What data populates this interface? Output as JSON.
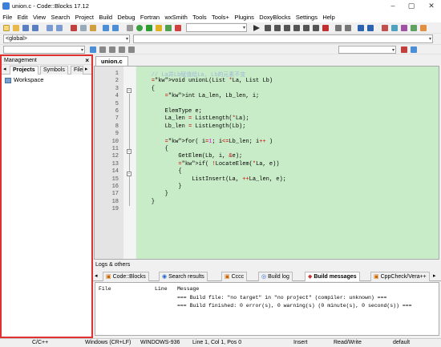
{
  "window": {
    "title": "union.c - Code::Blocks 17.12"
  },
  "menu": [
    "File",
    "Edit",
    "View",
    "Search",
    "Project",
    "Build",
    "Debug",
    "Fortran",
    "wxSmith",
    "Tools",
    "Tools+",
    "Plugins",
    "DoxyBlocks",
    "Settings",
    "Help"
  ],
  "toolbar": {
    "scope_combo": "<global>"
  },
  "management": {
    "title": "Management",
    "close": "×",
    "tabs": [
      "Projects",
      "Symbols",
      "Files"
    ],
    "workspace": "Workspace"
  },
  "editor": {
    "tab": "union.c",
    "lines": [
      {
        "n": "1",
        "t": "    // La并Lb赋值给La, Lb的元素不变"
      },
      {
        "n": "2",
        "t": "    void unionL(List *La, List Lb)"
      },
      {
        "n": "3",
        "t": "    {"
      },
      {
        "n": "4",
        "t": "        int La_len, Lb_len, i;"
      },
      {
        "n": "5",
        "t": ""
      },
      {
        "n": "6",
        "t": "        ElemType e;"
      },
      {
        "n": "7",
        "t": "        La_len = ListLength(*La);"
      },
      {
        "n": "8",
        "t": "        Lb_len = ListLength(Lb);"
      },
      {
        "n": "9",
        "t": ""
      },
      {
        "n": "10",
        "t": "        for( i=1; i<=Lb_len; i++ )"
      },
      {
        "n": "11",
        "t": "        {"
      },
      {
        "n": "12",
        "t": "            GetElem(Lb, i, &e);"
      },
      {
        "n": "13",
        "t": "            if( !LocateElem(*La, e))"
      },
      {
        "n": "14",
        "t": "            {"
      },
      {
        "n": "15",
        "t": "                ListInsert(La, ++La_len, e);"
      },
      {
        "n": "16",
        "t": "            }"
      },
      {
        "n": "17",
        "t": "        }"
      },
      {
        "n": "18",
        "t": "    }"
      },
      {
        "n": "19",
        "t": ""
      }
    ]
  },
  "logs": {
    "title": "Logs & others",
    "tabs": [
      "Code::Blocks",
      "Search results",
      "Cccc",
      "Build log",
      "Build messages",
      "CppCheck/Vera++"
    ],
    "columns": [
      "File",
      "Line",
      "Message"
    ],
    "messages": [
      "=== Build file: \"no target\" in \"no project\" (compiler: unknown) ===",
      "=== Build finished: 0 error(s), 0 warning(s) (0 minute(s), 0 second(s)) ==="
    ]
  },
  "status": {
    "lang": "C/C++",
    "eol": "Windows (CR+LF)",
    "enc": "WINDOWS-936",
    "pos": "Line 1, Col 1, Pos 0",
    "mode": "Insert",
    "rw": "Read/Write",
    "profile": "default"
  }
}
